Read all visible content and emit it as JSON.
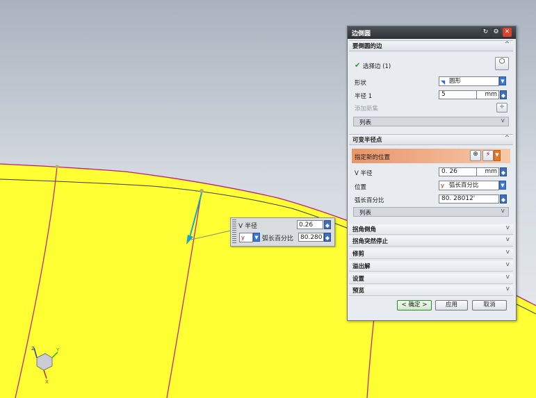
{
  "dialog": {
    "title": "边倒圆",
    "section_edges": {
      "title": "要倒圆的边"
    },
    "select_edge": {
      "label": "选择边 (1)"
    },
    "shape": {
      "label": "形状",
      "value": "圆形"
    },
    "radius": {
      "label": "半径 1",
      "value": "5",
      "unit": "mm"
    },
    "add_new_set": {
      "label": "添加新集"
    },
    "list1": {
      "label": "列表"
    },
    "section_variable": {
      "title": "可变半径点"
    },
    "specify_location": {
      "label": "指定新的位置"
    },
    "v_radius": {
      "label": "V 半径",
      "value": "0. 26",
      "unit": "mm"
    },
    "location": {
      "label": "位置",
      "value": "弧长百分比"
    },
    "arc_percent": {
      "label": "弧长百分比",
      "value": "80. 28012'"
    },
    "list2": {
      "label": "列表"
    },
    "collapsed_sections": [
      "拐角倒角",
      "拐角突然停止",
      "修剪",
      "溢出解",
      "设置",
      "预览"
    ],
    "buttons": {
      "ok": "< 确定 >",
      "apply": "应用",
      "cancel": "取消"
    }
  },
  "float_input": {
    "v_radius_label": "V 半径",
    "v_radius_value": "0.26",
    "arc_label": "弧长百分比",
    "arc_value": "80.280"
  },
  "colors": {
    "surface": "#ffff33",
    "edge": "#c2187a",
    "arrow": "#1aa5c8"
  },
  "icons": [
    "check-icon",
    "edge-select-icon",
    "shape-arc-icon",
    "add-set-icon",
    "point-dialog-icon",
    "point-icon",
    "triad-icon"
  ]
}
